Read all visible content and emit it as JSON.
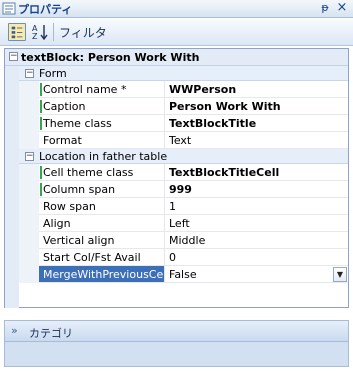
{
  "window": {
    "title": "プロパティ",
    "pin_glyph": "ᵽ",
    "close_glyph": "×"
  },
  "toolbar": {
    "filter_label": "フィルタ"
  },
  "object": {
    "label": "textBlock: Person Work With",
    "expander": "−"
  },
  "categories": [
    {
      "label": "Form",
      "expander": "−",
      "properties": [
        {
          "name": "Control name *",
          "value": "WWPerson",
          "bold": true,
          "marked": true
        },
        {
          "name": "Caption",
          "value": "Person Work With",
          "bold": true,
          "marked": true
        },
        {
          "name": "Theme class",
          "value": "TextBlockTitle",
          "bold": true,
          "marked": true
        },
        {
          "name": "Format",
          "value": "Text",
          "bold": false,
          "marked": false
        }
      ]
    },
    {
      "label": "Location in father table",
      "expander": "−",
      "properties": [
        {
          "name": "Cell theme class",
          "value": "TextBlockTitleCell",
          "bold": true,
          "marked": true
        },
        {
          "name": "Column span",
          "value": "999",
          "bold": true,
          "marked": true
        },
        {
          "name": "Row span",
          "value": "1",
          "bold": false,
          "marked": false
        },
        {
          "name": "Align",
          "value": "Left",
          "bold": false,
          "marked": false
        },
        {
          "name": "Vertical align",
          "value": "Middle",
          "bold": false,
          "marked": false
        },
        {
          "name": "Start Col/Fst Avail",
          "value": "0",
          "bold": false,
          "marked": false
        },
        {
          "name": "MergeWithPreviousCell",
          "value": "False",
          "bold": false,
          "marked": false,
          "selected": true,
          "dropdown": true
        }
      ]
    }
  ],
  "bottom": {
    "label": "カテゴリ",
    "chevron": "»"
  },
  "colors": {
    "selection": "#3d6fb9",
    "modified_marker": "#36a84a",
    "title_text": "#15428b"
  }
}
